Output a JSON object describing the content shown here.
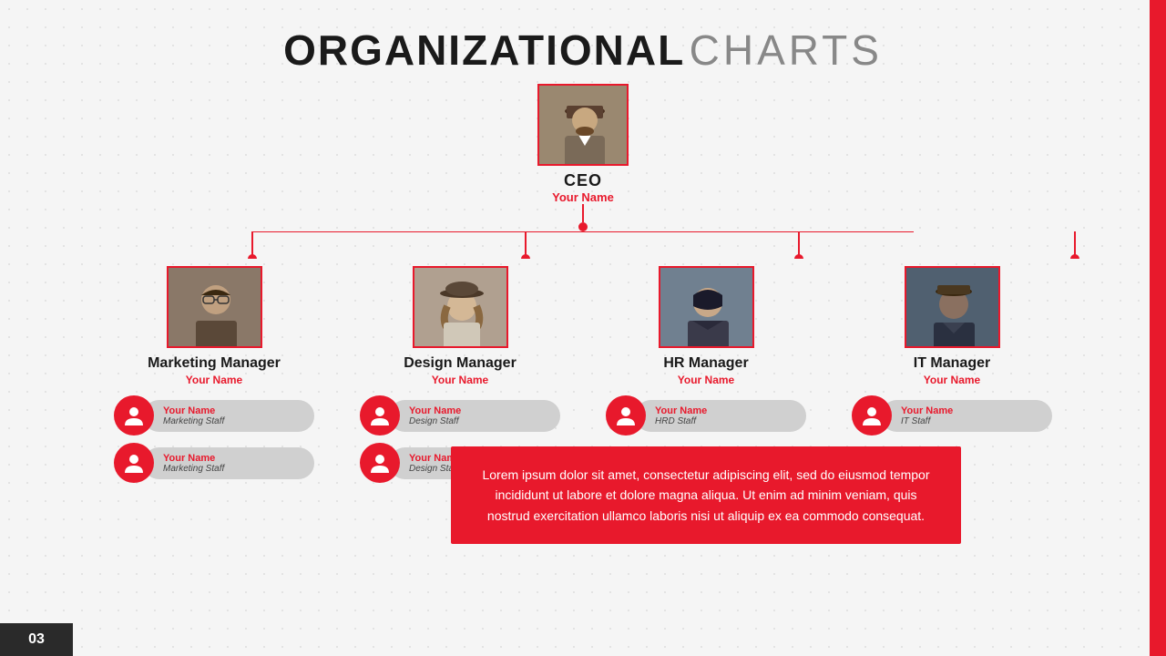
{
  "title": {
    "bold": "ORGANIZATIONAL",
    "light": "CHARTS"
  },
  "ceo": {
    "role": "CEO",
    "name": "Your Name"
  },
  "managers": [
    {
      "id": "marketing",
      "role": "Marketing Manager",
      "name": "Your Name",
      "staff": [
        {
          "name": "Your Name",
          "role": "Marketing Staff"
        },
        {
          "name": "Your Name",
          "role": "Marketing Staff"
        }
      ]
    },
    {
      "id": "design",
      "role": "Design Manager",
      "name": "Your Name",
      "staff": [
        {
          "name": "Your Name",
          "role": "Design Staff"
        },
        {
          "name": "Your Name",
          "role": "Design Staff"
        }
      ]
    },
    {
      "id": "hr",
      "role": "HR Manager",
      "name": "Your Name",
      "staff": [
        {
          "name": "Your Name",
          "role": "HRD Staff"
        }
      ]
    },
    {
      "id": "it",
      "role": "IT Manager",
      "name": "Your Name",
      "staff": [
        {
          "name": "Your Name",
          "role": "IT Staff"
        }
      ]
    }
  ],
  "lorem_text": "Lorem ipsum dolor sit amet, consectetur adipiscing elit, sed do eiusmod tempor incididunt ut labore et dolore magna aliqua. Ut enim ad minim veniam, quis nostrud exercitation ullamco laboris nisi ut aliquip ex ea commodo consequat.",
  "page_number": "03",
  "colors": {
    "accent": "#e8192c",
    "dark": "#1a1a1a",
    "gray": "#888"
  }
}
